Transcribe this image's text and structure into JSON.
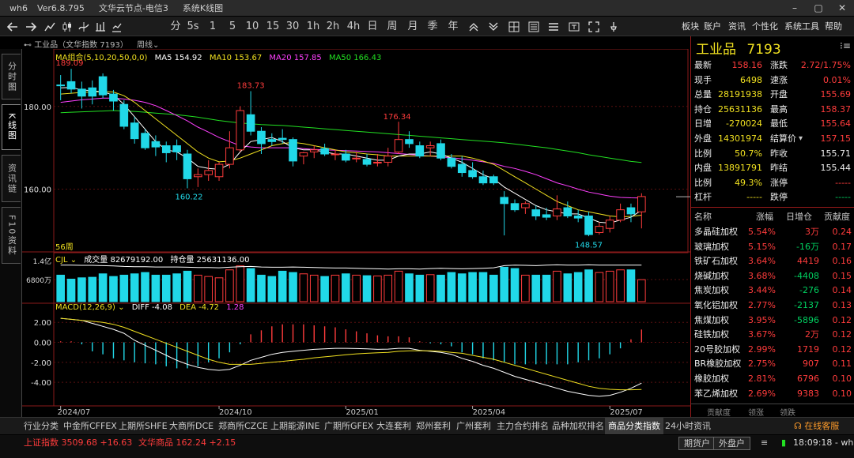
{
  "window": {
    "app": "wh6",
    "version": "Ver6.8.795",
    "title": "文华云节点-电信3",
    "view": "系统K线图"
  },
  "window_controls": {
    "minimize": "–",
    "maximize": "▢",
    "close": "✕"
  },
  "toolbar": {
    "left_icons": [
      "back-arrow-icon",
      "forward-arrow-icon",
      "line-chart-icon",
      "candlestick-icon",
      "trend-icon",
      "tick-icon",
      "bar-icon"
    ],
    "periods": [
      "分",
      "5s",
      "1",
      "5",
      "10",
      "15",
      "30",
      "1h",
      "2h",
      "4h",
      "日",
      "周",
      "月",
      "季",
      "年"
    ],
    "right_icons": [
      "zoom-in-icon",
      "zoom-out-icon",
      "grid-icon",
      "list-icon",
      "menu-icon",
      "text-icon",
      "fullscreen-icon",
      "pin-icon"
    ],
    "menus": [
      "板块",
      "账户",
      "资讯",
      "个性化",
      "系统工具",
      "帮助"
    ]
  },
  "left_tabs": [
    "分时图",
    "K线图",
    "资讯链",
    "F10资料"
  ],
  "chart_header": {
    "name": "工业品（文华指数 7193）",
    "period": "周线",
    "period_arrow": "⌄"
  },
  "ma_legend": {
    "label": "MA组合(5,10,20,50,0,0)",
    "items": [
      {
        "text": "MA5 154.92",
        "color": "#ffffff"
      },
      {
        "text": "MA10 153.67",
        "color": "#f0e020"
      },
      {
        "text": "MA20 157.85",
        "color": "#ff40ff"
      },
      {
        "text": "MA50 166.43",
        "color": "#22e022"
      }
    ]
  },
  "vol_legend": {
    "label": "CJL",
    "vol": "成交量 82679192.00",
    "oi": "持仓量 25631136.00",
    "y1": "1.4亿",
    "y2": "6800万"
  },
  "macd_legend": {
    "label": "MACD(12,26,9)",
    "diff": "DIFF -4.08",
    "dea": "DEA -4.72",
    "macd": "1.28"
  },
  "price_axis": [
    "180.00",
    "160.00"
  ],
  "macd_axis": [
    "2.00",
    "0.00",
    "-2.00",
    "-4.00"
  ],
  "time_axis": [
    "2024/07",
    "2024/10",
    "2025/01",
    "2025/04",
    "2025/07"
  ],
  "weeks_label": "56周",
  "annotations": {
    "high1": "189.09",
    "high2": "183.73",
    "high3": "176.34",
    "low1": "160.22",
    "low2": "148.57"
  },
  "quote": {
    "name": "工业品",
    "code": "7193",
    "rows": [
      {
        "l1": "最新",
        "v1": "158.16",
        "c1": "red",
        "l2": "涨跌",
        "v2": "2.72/1.75%",
        "c2": "red"
      },
      {
        "l1": "现手",
        "v1": "6498",
        "c1": "yellow",
        "l2": "速涨",
        "v2": "0.01%",
        "c2": "red"
      },
      {
        "l1": "总量",
        "v1": "28191938",
        "c1": "yellow",
        "l2": "开盘",
        "v2": "155.69",
        "c2": "red"
      },
      {
        "l1": "持仓",
        "v1": "25631136",
        "c1": "yellow",
        "l2": "最高",
        "v2": "158.37",
        "c2": "red"
      },
      {
        "l1": "日增",
        "v1": "-270024",
        "c1": "yellow",
        "l2": "最低",
        "v2": "155.64",
        "c2": "red"
      },
      {
        "l1": "外盘",
        "v1": "14301974",
        "c1": "yellow",
        "l2": "结算价",
        "v2": "157.15",
        "c2": "red"
      },
      {
        "l1": "比例",
        "v1": "50.7%",
        "c1": "yellow",
        "l2": "昨收",
        "v2": "155.71",
        "c2": "white"
      },
      {
        "l1": "内盘",
        "v1": "13891791",
        "c1": "yellow",
        "l2": "昨结",
        "v2": "155.44",
        "c2": "white"
      },
      {
        "l1": "比例",
        "v1": "49.3%",
        "c1": "yellow",
        "l2": "涨停",
        "v2": "-----",
        "c2": "red"
      },
      {
        "l1": "杠杆",
        "v1": "-----",
        "c1": "yellow",
        "l2": "跌停",
        "v2": "-----",
        "c2": "green"
      }
    ]
  },
  "sector": {
    "headers": [
      "名称",
      "涨幅",
      "日增仓",
      "贡献度"
    ],
    "rows": [
      [
        "多晶硅加权",
        "5.54%",
        "3万",
        "0.24"
      ],
      [
        "玻璃加权",
        "5.15%",
        "-16万",
        "0.17"
      ],
      [
        "铁矿石加权",
        "3.64%",
        "4419",
        "0.16"
      ],
      [
        "烧碱加权",
        "3.68%",
        "-4408",
        "0.15"
      ],
      [
        "焦炭加权",
        "3.44%",
        "-276",
        "0.14"
      ],
      [
        "氧化铝加权",
        "2.77%",
        "-2137",
        "0.13"
      ],
      [
        "焦煤加权",
        "3.95%",
        "-5896",
        "0.12"
      ],
      [
        "硅铁加权",
        "3.67%",
        "2万",
        "0.12"
      ],
      [
        "20号胶加权",
        "2.99%",
        "1719",
        "0.12"
      ],
      [
        "BR橡胶加权",
        "2.75%",
        "907",
        "0.11"
      ],
      [
        "橡胶加权",
        "2.81%",
        "6796",
        "0.10"
      ],
      [
        "苯乙烯加权",
        "2.69%",
        "9383",
        "0.10"
      ]
    ],
    "bottom_tabs": [
      "贡献度",
      "领涨",
      "领跌"
    ]
  },
  "bottom_tabs": [
    "行业分类",
    "中金所CFFEX",
    "上期所SHFE",
    "大商所DCE",
    "郑商所CZCE",
    "上期能源INE",
    "广期所GFEX",
    "大连套利",
    "郑州套利",
    "广州套利",
    "主力合约排名",
    "品种加权排名",
    "商品分类指数",
    "24小时资讯"
  ],
  "active_bottom_tab": "商品分类指数",
  "online_service": "在线客服",
  "status": {
    "sh_label": "上证指数",
    "sh_value": "3509.68",
    "sh_change": "+16.63",
    "wh_label": "文华商品",
    "wh_value": "162.24",
    "wh_change": "+2.15",
    "btn1": "期货户",
    "btn2": "外盘户",
    "time": "18:09:18 - wh"
  },
  "chart_data": {
    "type": "candlestick",
    "period": "weekly",
    "candles": [
      {
        "o": 185.2,
        "h": 187.6,
        "l": 181.5,
        "c": 185.0
      },
      {
        "o": 186.0,
        "h": 189.1,
        "l": 183.2,
        "c": 184.2
      },
      {
        "o": 184.2,
        "h": 186.0,
        "l": 179.5,
        "c": 182.5
      },
      {
        "o": 184.5,
        "h": 186.3,
        "l": 180.5,
        "c": 182.5
      },
      {
        "o": 187.2,
        "h": 188.0,
        "l": 182.0,
        "c": 182.8
      },
      {
        "o": 183.0,
        "h": 184.0,
        "l": 179.0,
        "c": 181.3
      },
      {
        "o": 180.5,
        "h": 181.5,
        "l": 174.5,
        "c": 175.2
      },
      {
        "o": 176.0,
        "h": 177.5,
        "l": 171.0,
        "c": 172.2
      },
      {
        "o": 173.5,
        "h": 174.5,
        "l": 169.5,
        "c": 170.0
      },
      {
        "o": 171.5,
        "h": 173.0,
        "l": 168.0,
        "c": 170.2
      },
      {
        "o": 170.5,
        "h": 171.5,
        "l": 166.5,
        "c": 168.8
      },
      {
        "o": 170.5,
        "h": 172.0,
        "l": 167.0,
        "c": 169.0
      },
      {
        "o": 168.5,
        "h": 169.5,
        "l": 160.2,
        "c": 162.5
      },
      {
        "o": 163.0,
        "h": 165.0,
        "l": 160.5,
        "c": 163.5
      },
      {
        "o": 163.5,
        "h": 167.0,
        "l": 162.0,
        "c": 164.5
      },
      {
        "o": 163.0,
        "h": 166.5,
        "l": 162.0,
        "c": 166.0
      },
      {
        "o": 166.0,
        "h": 174.0,
        "l": 165.0,
        "c": 170.0
      },
      {
        "o": 169.5,
        "h": 180.0,
        "l": 169.0,
        "c": 179.0
      },
      {
        "o": 178.0,
        "h": 183.7,
        "l": 173.0,
        "c": 174.0
      },
      {
        "o": 174.0,
        "h": 175.0,
        "l": 168.5,
        "c": 171.0
      },
      {
        "o": 172.0,
        "h": 173.5,
        "l": 170.5,
        "c": 171.5
      },
      {
        "o": 172.3,
        "h": 174.5,
        "l": 171.0,
        "c": 172.0
      },
      {
        "o": 172.0,
        "h": 172.5,
        "l": 165.5,
        "c": 166.8
      },
      {
        "o": 168.0,
        "h": 169.0,
        "l": 166.0,
        "c": 168.8
      },
      {
        "o": 169.0,
        "h": 170.5,
        "l": 167.5,
        "c": 169.5
      },
      {
        "o": 169.8,
        "h": 171.0,
        "l": 168.0,
        "c": 168.5
      },
      {
        "o": 168.5,
        "h": 169.5,
        "l": 167.0,
        "c": 168.5
      },
      {
        "o": 168.5,
        "h": 169.5,
        "l": 166.5,
        "c": 167.0
      },
      {
        "o": 167.5,
        "h": 169.0,
        "l": 166.5,
        "c": 167.5
      },
      {
        "o": 167.2,
        "h": 168.5,
        "l": 165.5,
        "c": 166.0
      },
      {
        "o": 166.5,
        "h": 168.5,
        "l": 165.5,
        "c": 166.5
      },
      {
        "o": 166.5,
        "h": 170.0,
        "l": 165.5,
        "c": 168.0
      },
      {
        "o": 169.0,
        "h": 176.3,
        "l": 168.5,
        "c": 172.0
      },
      {
        "o": 172.0,
        "h": 174.0,
        "l": 170.0,
        "c": 171.0
      },
      {
        "o": 170.5,
        "h": 171.5,
        "l": 167.5,
        "c": 168.0
      },
      {
        "o": 170.0,
        "h": 171.5,
        "l": 168.0,
        "c": 170.5
      },
      {
        "o": 171.0,
        "h": 172.0,
        "l": 167.0,
        "c": 167.5
      },
      {
        "o": 167.5,
        "h": 168.5,
        "l": 165.0,
        "c": 165.5
      },
      {
        "o": 166.0,
        "h": 168.0,
        "l": 163.0,
        "c": 164.0
      },
      {
        "o": 164.5,
        "h": 166.5,
        "l": 162.5,
        "c": 163.0
      },
      {
        "o": 163.0,
        "h": 164.5,
        "l": 161.0,
        "c": 161.5
      },
      {
        "o": 163.0,
        "h": 163.5,
        "l": 161.0,
        "c": 161.5
      },
      {
        "o": 158.0,
        "h": 159.5,
        "l": 148.8,
        "c": 156.5
      },
      {
        "o": 156.5,
        "h": 157.5,
        "l": 154.5,
        "c": 155.0
      },
      {
        "o": 155.5,
        "h": 157.0,
        "l": 154.0,
        "c": 156.5
      },
      {
        "o": 155.0,
        "h": 156.0,
        "l": 152.5,
        "c": 153.5
      },
      {
        "o": 153.8,
        "h": 155.5,
        "l": 152.5,
        "c": 153.2
      },
      {
        "o": 153.5,
        "h": 158.5,
        "l": 152.5,
        "c": 155.2
      },
      {
        "o": 155.5,
        "h": 157.0,
        "l": 153.0,
        "c": 153.5
      },
      {
        "o": 153.5,
        "h": 155.0,
        "l": 152.0,
        "c": 153.0
      },
      {
        "o": 153.5,
        "h": 154.5,
        "l": 148.6,
        "c": 149.0
      },
      {
        "o": 149.5,
        "h": 152.0,
        "l": 149.0,
        "c": 151.0
      },
      {
        "o": 150.5,
        "h": 153.5,
        "l": 149.5,
        "c": 152.5
      },
      {
        "o": 152.5,
        "h": 156.5,
        "l": 152.0,
        "c": 155.0
      },
      {
        "o": 155.5,
        "h": 156.5,
        "l": 152.0,
        "c": 154.0
      },
      {
        "o": 154.5,
        "h": 159.0,
        "l": 150.5,
        "c": 158.2
      }
    ],
    "ma5": [
      184.5,
      184.6,
      184.0,
      183.8,
      183.5,
      182.8,
      180.5,
      177.5,
      174.5,
      171.5,
      169.5,
      169.0,
      167.5,
      165.5,
      165.0,
      164.8,
      166.0,
      169.0,
      171.5,
      172.0,
      172.5,
      171.5,
      170.0,
      169.5,
      169.5,
      169.0,
      168.5,
      168.5,
      168.0,
      167.5,
      167.0,
      167.0,
      168.0,
      168.5,
      168.5,
      169.0,
      168.5,
      167.5,
      166.5,
      165.0,
      163.5,
      162.5,
      160.5,
      159.0,
      157.5,
      156.0,
      155.0,
      154.5,
      154.0,
      154.0,
      153.0,
      152.0,
      151.8,
      152.5,
      153.2,
      154.9
    ],
    "ma10": [
      183.0,
      183.2,
      183.4,
      183.5,
      183.6,
      183.5,
      182.6,
      181.0,
      179.0,
      177.0,
      175.0,
      173.0,
      171.0,
      169.0,
      167.5,
      166.6,
      166.8,
      167.5,
      168.5,
      169.5,
      170.5,
      171.0,
      171.3,
      171.0,
      170.5,
      170.0,
      169.5,
      169.0,
      168.8,
      168.5,
      168.3,
      168.0,
      168.0,
      168.0,
      168.0,
      168.0,
      168.0,
      168.0,
      168.0,
      167.5,
      166.8,
      166.0,
      164.5,
      163.0,
      161.5,
      160.0,
      158.5,
      157.0,
      156.0,
      155.0,
      154.5,
      154.0,
      153.5,
      153.3,
      153.4,
      153.7
    ],
    "ma20": [
      181.0,
      181.3,
      181.6,
      181.8,
      182.0,
      182.0,
      181.8,
      181.5,
      181.0,
      180.2,
      179.0,
      177.8,
      176.5,
      175.0,
      173.8,
      172.5,
      171.5,
      170.5,
      170.2,
      170.0,
      170.0,
      170.0,
      170.0,
      169.8,
      169.6,
      169.5,
      169.4,
      169.3,
      169.2,
      169.1,
      169.0,
      168.8,
      168.6,
      168.4,
      168.2,
      168.0,
      167.8,
      167.6,
      167.3,
      167.0,
      166.6,
      166.2,
      165.5,
      165.0,
      164.3,
      163.5,
      162.5,
      161.5,
      160.8,
      160.0,
      159.3,
      158.8,
      158.3,
      158.0,
      157.9,
      157.85
    ],
    "ma50": [
      178.5,
      178.6,
      178.7,
      178.8,
      178.9,
      179.0,
      178.9,
      178.8,
      178.6,
      178.4,
      178.2,
      178.0,
      177.7,
      177.4,
      177.0,
      176.6,
      176.3,
      176.0,
      175.8,
      175.6,
      175.5,
      175.4,
      175.2,
      175.0,
      174.8,
      174.6,
      174.4,
      174.2,
      174.0,
      173.8,
      173.6,
      173.4,
      173.2,
      173.0,
      172.8,
      172.6,
      172.4,
      172.2,
      172.0,
      171.8,
      171.6,
      171.4,
      171.2,
      170.9,
      170.6,
      170.3,
      170.0,
      169.6,
      169.2,
      168.8,
      168.3,
      167.9,
      167.5,
      167.1,
      166.7,
      166.43
    ],
    "volume": [
      1.0,
      0.85,
      0.9,
      0.92,
      1.05,
      0.95,
      1.0,
      1.05,
      1.1,
      1.0,
      1.0,
      1.05,
      1.15,
      1.0,
      0.95,
      0.9,
      1.2,
      1.35,
      1.25,
      1.0,
      0.95,
      1.15,
      1.1,
      1.05,
      1.0,
      0.95,
      1.0,
      1.05,
      1.0,
      0.98,
      0.97,
      1.0,
      1.15,
      1.05,
      1.0,
      1.02,
      1.0,
      1.1,
      1.05,
      1.1,
      1.1,
      1.0,
      1.3,
      1.25,
      1.0,
      1.0,
      1.0,
      1.15,
      1.05,
      1.1,
      1.2,
      1.1,
      1.15,
      1.2,
      1.2,
      0.83
    ],
    "vol_axis_labels": {
      "1.4亿": 1.4,
      "6800万": 0.68
    },
    "oi_line": [
      1.38,
      1.38,
      1.37,
      1.37,
      1.36,
      1.35,
      1.33,
      1.32,
      1.32,
      1.31,
      1.31,
      1.31,
      1.3,
      1.29,
      1.29,
      1.28,
      1.3,
      1.32,
      1.33,
      1.31,
      1.3,
      1.3,
      1.31,
      1.3,
      1.29,
      1.28,
      1.27,
      1.27,
      1.26,
      1.25,
      1.24,
      1.23,
      1.24,
      1.24,
      1.23,
      1.25,
      1.26,
      1.25,
      1.24,
      1.25,
      1.26,
      1.28,
      1.36,
      1.38,
      1.37,
      1.36,
      1.38,
      1.39,
      1.38,
      1.38,
      1.39,
      1.38,
      1.38,
      1.38,
      1.38,
      1.38
    ],
    "diff": [
      2.4,
      2.3,
      2.2,
      1.9,
      1.6,
      1.3,
      0.9,
      0.2,
      -0.3,
      -0.8,
      -1.3,
      -1.8,
      -2.2,
      -2.5,
      -2.7,
      -2.8,
      -2.7,
      -2.3,
      -1.8,
      -1.5,
      -1.2,
      -1.0,
      -0.9,
      -0.8,
      -0.7,
      -0.65,
      -0.6,
      -0.6,
      -0.62,
      -0.65,
      -0.7,
      -0.68,
      -0.6,
      -0.6,
      -0.8,
      -0.9,
      -1.0,
      -1.2,
      -1.6,
      -1.9,
      -2.3,
      -2.6,
      -3.0,
      -3.4,
      -3.7,
      -4.0,
      -4.3,
      -4.6,
      -4.9,
      -5.1,
      -5.3,
      -5.4,
      -5.3,
      -5.0,
      -4.6,
      -4.08
    ],
    "dea": [
      2.4,
      2.3,
      2.2,
      2.1,
      2.0,
      1.8,
      1.5,
      1.1,
      0.7,
      0.3,
      -0.1,
      -0.5,
      -0.9,
      -1.3,
      -1.7,
      -2.0,
      -2.2,
      -2.2,
      -2.2,
      -2.1,
      -2.0,
      -1.9,
      -1.8,
      -1.7,
      -1.55,
      -1.45,
      -1.35,
      -1.25,
      -1.15,
      -1.1,
      -1.05,
      -1.0,
      -0.9,
      -0.85,
      -0.85,
      -0.85,
      -0.9,
      -1.0,
      -1.1,
      -1.3,
      -1.5,
      -1.7,
      -2.0,
      -2.3,
      -2.6,
      -2.9,
      -3.2,
      -3.5,
      -3.8,
      -4.1,
      -4.4,
      -4.6,
      -4.7,
      -4.75,
      -4.75,
      -4.72
    ],
    "macd": [
      0.1,
      0.1,
      -0.2,
      -0.9,
      -1.2,
      -1.6,
      -1.8,
      -2.0,
      -2.1,
      -2.2,
      -2.4,
      -2.6,
      -2.6,
      -2.4,
      -2.0,
      -1.6,
      -1.0,
      -0.2,
      0.8,
      1.2,
      1.6,
      1.8,
      1.8,
      1.8,
      1.7,
      1.6,
      1.5,
      1.3,
      1.1,
      0.9,
      0.7,
      0.6,
      0.6,
      0.5,
      0.1,
      -0.1,
      -0.2,
      -0.4,
      -1.0,
      -1.2,
      -1.6,
      -1.8,
      -2.0,
      -2.2,
      -2.2,
      -2.2,
      -2.2,
      -2.2,
      -2.2,
      -2.0,
      -1.8,
      -1.6,
      -1.2,
      -0.6,
      0.3,
      1.28
    ],
    "price_range": [
      145,
      192
    ],
    "macd_range": [
      -6.2,
      3.2
    ]
  }
}
